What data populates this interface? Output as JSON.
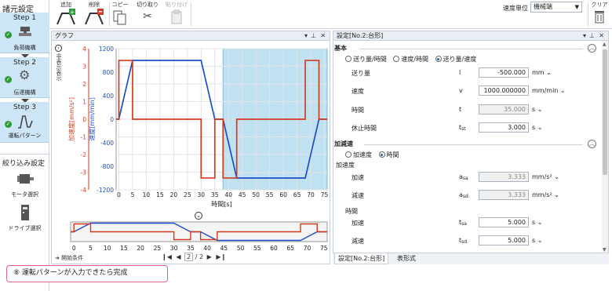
{
  "left": {
    "title": "諸元設定",
    "steps": [
      {
        "label": "Step 1",
        "sub": "負荷機構"
      },
      {
        "label": "Step 2",
        "sub": "伝達機構"
      },
      {
        "label": "Step 3",
        "sub": "運転パターン"
      }
    ],
    "filter_title": "絞り込み設定",
    "motor_select": "モータ選択",
    "drive_select": "ドライブ選択"
  },
  "toolbar": {
    "add": "追加",
    "remove": "削除",
    "copy": "コピー",
    "cut": "切り取り",
    "paste": "貼り付け",
    "speed_unit_label": "速度単位",
    "speed_unit_value": "機械端",
    "clear": "クリア"
  },
  "graph_panel": {
    "title": "グラフ",
    "side_label": "非表示表示",
    "start_condition": "開始条件",
    "page_current": "2",
    "page_total": "/ 2"
  },
  "settings_panel": {
    "title": "設定[No.2:台形]",
    "basic": {
      "header": "基本",
      "modes": [
        "送り量/時間",
        "速度/時間",
        "送り量/速度"
      ],
      "selected_mode": 2,
      "rows": [
        {
          "label": "送り量",
          "sym": "l",
          "value": "-500.000",
          "unit": "mm",
          "readonly": false
        },
        {
          "label": "速度",
          "sym": "v",
          "value": "1000.000000",
          "unit": "mm/min",
          "readonly": false
        },
        {
          "label": "時間",
          "sym": "t",
          "value": "35.000",
          "unit": "s",
          "readonly": true
        },
        {
          "label": "休止時間",
          "sym": "tst",
          "value": "3.000",
          "unit": "s",
          "readonly": false
        }
      ]
    },
    "accel": {
      "header": "加減速",
      "modes": [
        "加速度",
        "時間"
      ],
      "selected_mode": 1,
      "sub1": "加速度",
      "rows1": [
        {
          "label": "加速",
          "sym": "asa",
          "value": "3.333",
          "unit": "mm/s²",
          "readonly": true
        },
        {
          "label": "減速",
          "sym": "asd",
          "value": "3.333",
          "unit": "mm/s²",
          "readonly": true
        }
      ],
      "sub2": "時間",
      "rows2": [
        {
          "label": "加速",
          "sym": "tsa",
          "value": "5.000",
          "unit": "s",
          "readonly": false
        },
        {
          "label": "減速",
          "sym": "tsd",
          "value": "5.000",
          "unit": "s",
          "readonly": false
        }
      ]
    },
    "tabs": [
      "設定[No.2:台形]",
      "表形式"
    ]
  },
  "callout": "⑧ 運転パターンが入力できたら完成",
  "colors": {
    "speed": "#1f4fc8",
    "accel": "#d23c1e",
    "highlight": "#bfe1f2",
    "step_bg": "#cde6f7"
  },
  "chart_data": [
    {
      "type": "line",
      "xlabel": "時間[s]",
      "ylabel_left": "加速度[mm/s²]",
      "ylabel_right": "速度[mm/min]",
      "x_ticks": [
        0,
        5,
        10,
        15,
        20,
        25,
        30,
        35,
        40,
        45,
        50,
        55,
        60,
        65,
        70,
        75
      ],
      "y_left_ticks": [
        4,
        3,
        2,
        1,
        0,
        -1,
        -2,
        -3,
        -4
      ],
      "y_right_ticks": [
        1200,
        800,
        400,
        0,
        -400,
        -800,
        -1200
      ],
      "xlim": [
        -1,
        76
      ],
      "ylim_left": [
        -4,
        4
      ],
      "ylim_right": [
        -1200,
        1200
      ],
      "highlight_range": [
        38,
        76
      ],
      "series": [
        {
          "axis": "right",
          "color": "#1f4fc8",
          "points": [
            [
              -1,
              0
            ],
            [
              0,
              0
            ],
            [
              5,
              1000
            ],
            [
              30,
              1000
            ],
            [
              35,
              0
            ],
            [
              38,
              0
            ],
            [
              43,
              -1000
            ],
            [
              68,
              -1000
            ],
            [
              73,
              0
            ],
            [
              76,
              0
            ]
          ]
        },
        {
          "axis": "left",
          "color": "#d23c1e",
          "points": [
            [
              -1,
              0
            ],
            [
              0,
              0
            ],
            [
              0,
              3.33
            ],
            [
              5,
              3.33
            ],
            [
              5,
              0
            ],
            [
              30,
              0
            ],
            [
              30,
              -3.33
            ],
            [
              35,
              -3.33
            ],
            [
              35,
              0
            ],
            [
              38,
              0
            ],
            [
              38,
              -3.33
            ],
            [
              43,
              -3.33
            ],
            [
              43,
              0
            ],
            [
              68,
              0
            ],
            [
              68,
              3.33
            ],
            [
              73,
              3.33
            ],
            [
              73,
              0
            ],
            [
              76,
              0
            ]
          ]
        }
      ]
    },
    {
      "type": "line",
      "x_ticks": [
        0,
        5,
        10,
        15,
        20,
        25,
        30,
        35,
        40,
        45,
        50,
        55,
        60,
        65,
        70,
        75
      ],
      "xlim": [
        -1,
        76
      ],
      "series": [
        {
          "color": "#1f4fc8",
          "points": [
            [
              -1,
              0
            ],
            [
              0,
              0
            ],
            [
              5,
              1000
            ],
            [
              30,
              1000
            ],
            [
              35,
              0
            ],
            [
              38,
              0
            ],
            [
              43,
              -1000
            ],
            [
              68,
              -1000
            ],
            [
              73,
              0
            ],
            [
              76,
              0
            ]
          ]
        },
        {
          "color": "#d23c1e",
          "points": [
            [
              -1,
              0
            ],
            [
              0,
              0
            ],
            [
              0,
              3.33
            ],
            [
              5,
              3.33
            ],
            [
              5,
              0
            ],
            [
              30,
              0
            ],
            [
              30,
              -3.33
            ],
            [
              35,
              -3.33
            ],
            [
              35,
              0
            ],
            [
              38,
              0
            ],
            [
              38,
              -3.33
            ],
            [
              43,
              -3.33
            ],
            [
              43,
              0
            ],
            [
              68,
              0
            ],
            [
              68,
              3.33
            ],
            [
              73,
              3.33
            ],
            [
              73,
              0
            ],
            [
              76,
              0
            ]
          ]
        }
      ]
    }
  ]
}
